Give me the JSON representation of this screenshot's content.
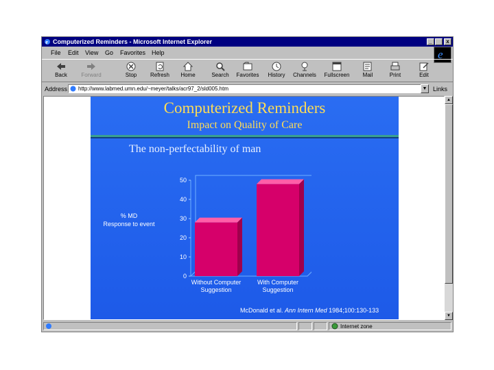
{
  "window": {
    "title": "Computerized Reminders - Microsoft Internet Explorer",
    "controls": [
      "_",
      " ",
      "x"
    ]
  },
  "menu": [
    "File",
    "Edit",
    "View",
    "Go",
    "Favorites",
    "Help"
  ],
  "toolbar": [
    {
      "label": "Back",
      "icon": "back-arrow-icon"
    },
    {
      "label": "Forward",
      "icon": "forward-arrow-icon"
    },
    {
      "label": "Stop",
      "icon": "stop-icon"
    },
    {
      "label": "Refresh",
      "icon": "refresh-icon"
    },
    {
      "label": "Home",
      "icon": "home-icon"
    },
    {
      "label": "Search",
      "icon": "search-icon"
    },
    {
      "label": "Favorites",
      "icon": "favorites-icon"
    },
    {
      "label": "History",
      "icon": "history-icon"
    },
    {
      "label": "Channels",
      "icon": "channels-icon"
    },
    {
      "label": "Fullscreen",
      "icon": "fullscreen-icon"
    },
    {
      "label": "Mail",
      "icon": "mail-icon"
    },
    {
      "label": "Print",
      "icon": "print-icon"
    },
    {
      "label": "Edit",
      "icon": "edit-icon"
    }
  ],
  "address": {
    "label": "Address",
    "url": "http://www.labmed.umn.edu/~meyer/talks/acr97_2/sld005.htm",
    "links_label": "Links"
  },
  "status": {
    "zone": "Internet zone"
  },
  "slide": {
    "title": "Computerized Reminders",
    "subtitle": "Impact on Quality of Care",
    "heading": "The non-perfectability of man",
    "ylabel_line1": "% MD",
    "ylabel_line2": "Response to event",
    "citation_authors": "McDonald et al.",
    "citation_journal": "Ann Intern Med",
    "citation_ref": "1984;100:130-133"
  },
  "colors": {
    "bar": "#d6006a",
    "bar_top": "#ff5fa8",
    "bar_side": "#a0004c",
    "slide_bg": "#2a6df2",
    "title": "#ffdd55"
  },
  "chart_data": {
    "type": "bar",
    "categories": [
      [
        "Without Computer",
        "Suggestion"
      ],
      [
        "With Computer",
        "Suggestion"
      ]
    ],
    "values": [
      28,
      48
    ],
    "ylim": [
      0,
      50
    ],
    "yticks": [
      0,
      10,
      20,
      30,
      40,
      50
    ],
    "ylabel": "% MD Response to event",
    "grid": false
  }
}
